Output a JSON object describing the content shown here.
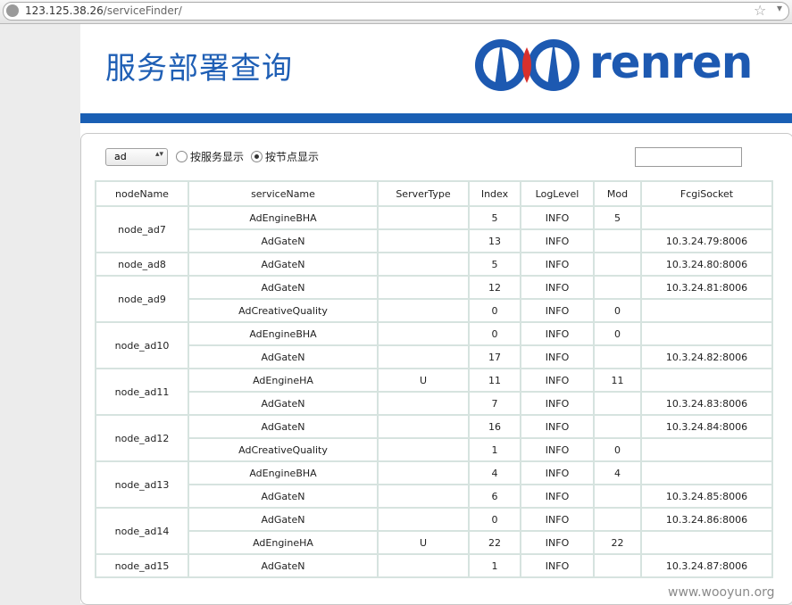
{
  "browser": {
    "url_host": "123.125.38.26",
    "url_path": "/serviceFinder/"
  },
  "header": {
    "title": "服务部署查询",
    "logo_text": "renren"
  },
  "controls": {
    "select_value": "ad",
    "radio_by_service": "按服务显示",
    "radio_by_node": "按节点显示",
    "selected": "按节点显示"
  },
  "table": {
    "columns": [
      "nodeName",
      "serviceName",
      "ServerType",
      "Index",
      "LogLevel",
      "Mod",
      "FcgiSocket"
    ],
    "groups": [
      {
        "node": "node_ad7",
        "rows": [
          [
            "AdEngineBHA",
            "",
            "5",
            "INFO",
            "5",
            ""
          ],
          [
            "AdGateN",
            "",
            "13",
            "INFO",
            "",
            "10.3.24.79:8006"
          ]
        ]
      },
      {
        "node": "node_ad8",
        "rows": [
          [
            "AdGateN",
            "",
            "5",
            "INFO",
            "",
            "10.3.24.80:8006"
          ]
        ]
      },
      {
        "node": "node_ad9",
        "rows": [
          [
            "AdGateN",
            "",
            "12",
            "INFO",
            "",
            "10.3.24.81:8006"
          ],
          [
            "AdCreativeQuality",
            "",
            "0",
            "INFO",
            "0",
            ""
          ]
        ]
      },
      {
        "node": "node_ad10",
        "rows": [
          [
            "AdEngineBHA",
            "",
            "0",
            "INFO",
            "0",
            ""
          ],
          [
            "AdGateN",
            "",
            "17",
            "INFO",
            "",
            "10.3.24.82:8006"
          ]
        ]
      },
      {
        "node": "node_ad11",
        "rows": [
          [
            "AdEngineHA",
            "U",
            "11",
            "INFO",
            "11",
            ""
          ],
          [
            "AdGateN",
            "",
            "7",
            "INFO",
            "",
            "10.3.24.83:8006"
          ]
        ]
      },
      {
        "node": "node_ad12",
        "rows": [
          [
            "AdGateN",
            "",
            "16",
            "INFO",
            "",
            "10.3.24.84:8006"
          ],
          [
            "AdCreativeQuality",
            "",
            "1",
            "INFO",
            "0",
            ""
          ]
        ]
      },
      {
        "node": "node_ad13",
        "rows": [
          [
            "AdEngineBHA",
            "",
            "4",
            "INFO",
            "4",
            ""
          ],
          [
            "AdGateN",
            "",
            "6",
            "INFO",
            "",
            "10.3.24.85:8006"
          ]
        ]
      },
      {
        "node": "node_ad14",
        "rows": [
          [
            "AdGateN",
            "",
            "0",
            "INFO",
            "",
            "10.3.24.86:8006"
          ],
          [
            "AdEngineHA",
            "U",
            "22",
            "INFO",
            "22",
            ""
          ]
        ]
      },
      {
        "node": "node_ad15",
        "rows": [
          [
            "AdGateN",
            "",
            "1",
            "INFO",
            "",
            "10.3.24.87:8006"
          ]
        ]
      }
    ]
  },
  "watermark": "www.wooyun.org",
  "colors": {
    "brand_blue": "#1a5fb4",
    "title_blue": "#1f5fb5",
    "logo_red": "#d9302c",
    "grid_border": "#d6e3df"
  }
}
